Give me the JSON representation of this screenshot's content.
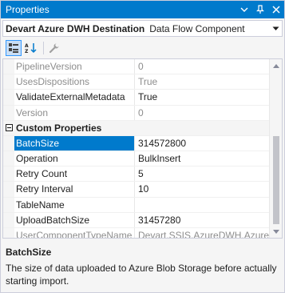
{
  "window": {
    "title": "Properties"
  },
  "selector": {
    "object_name": "Devart Azure DWH Destination",
    "object_type": "Data Flow Component"
  },
  "toolbar": {
    "buttons": [
      {
        "icon": "categorized-icon",
        "active": true
      },
      {
        "icon": "alphabetical-sort-icon",
        "active": false
      },
      {
        "icon": "property-pages-icon",
        "active": false
      }
    ]
  },
  "grid": {
    "rows_before": [
      {
        "name": "PipelineVersion",
        "value": "0",
        "disabled": true
      },
      {
        "name": "UsesDispositions",
        "value": "True",
        "disabled": true
      },
      {
        "name": "ValidateExternalMetadata",
        "value": "True",
        "disabled": false
      },
      {
        "name": "Version",
        "value": "0",
        "disabled": true
      }
    ],
    "category": {
      "label": "Custom Properties",
      "expanded": true
    },
    "custom_rows": [
      {
        "name": "BatchSize",
        "value": "314572800",
        "selected": true
      },
      {
        "name": "Operation",
        "value": "BulkInsert"
      },
      {
        "name": "Retry Count",
        "value": "5"
      },
      {
        "name": "Retry Interval",
        "value": "10"
      },
      {
        "name": "TableName",
        "value": ""
      },
      {
        "name": "UploadBatchSize",
        "value": "31457280"
      },
      {
        "name": "UserComponentTypeName",
        "value": "Devart.SSIS.AzureDWH.AzureDW",
        "disabled": true
      }
    ]
  },
  "description": {
    "title": "BatchSize",
    "text": "The size of data uploaded to Azure Blob Storage before actually starting import."
  },
  "colors": {
    "accent": "#007acc",
    "disabled_text": "#8d8d8d",
    "selected_bg": "#007acc"
  }
}
